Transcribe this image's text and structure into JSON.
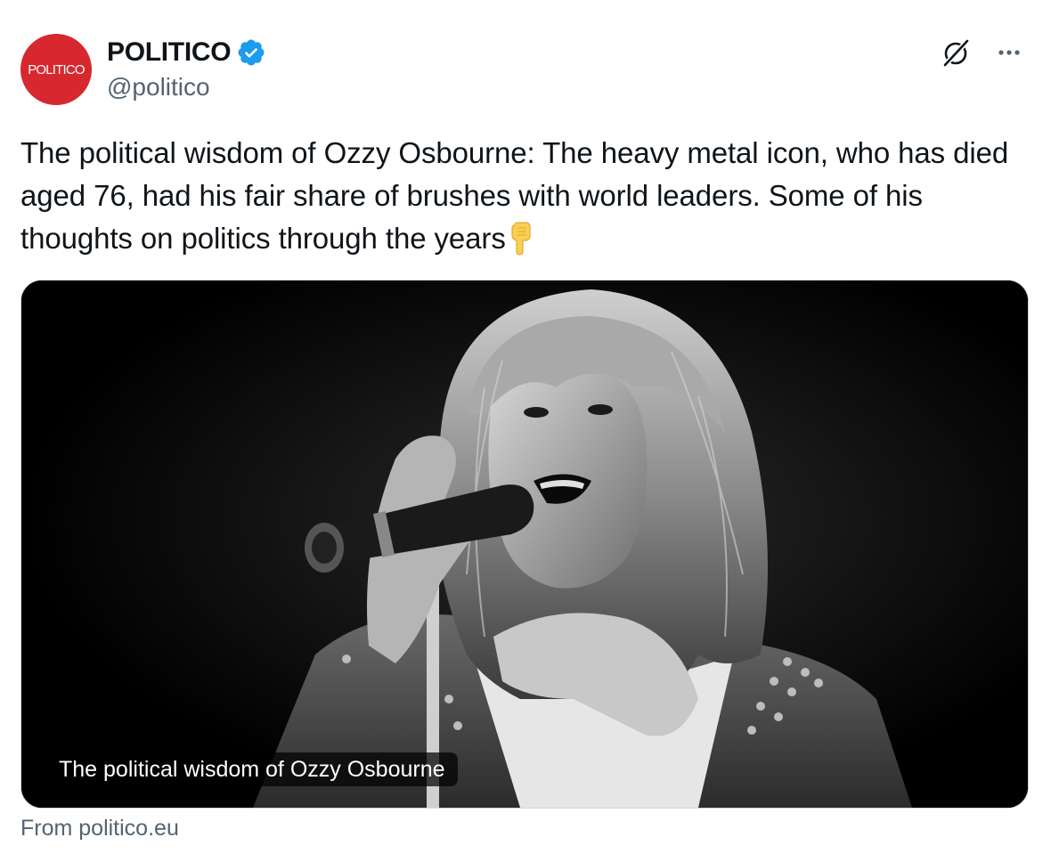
{
  "account": {
    "display_name": "POLITICO",
    "handle": "@politico",
    "avatar_text": "POLITICO",
    "avatar_color": "#d7282f",
    "verified_icon": "verified-badge-icon",
    "verified_color": "#1d9bf0"
  },
  "actions": {
    "grok_icon": "grok-icon",
    "more_icon": "more-horizontal-icon"
  },
  "tweet": {
    "text": "The political wisdom of Ozzy Osbourne: The heavy metal icon, who has died aged 76, had his fair share of brushes with world leaders. Some of his thoughts on politics through the years",
    "emoji": "👇"
  },
  "card": {
    "image_description_icon": "photo",
    "title": "The political wisdom of Ozzy Osbourne",
    "source": "From politico.eu"
  },
  "colors": {
    "text_primary": "#0f1419",
    "text_secondary": "#536471",
    "border": "#cfd9de"
  }
}
